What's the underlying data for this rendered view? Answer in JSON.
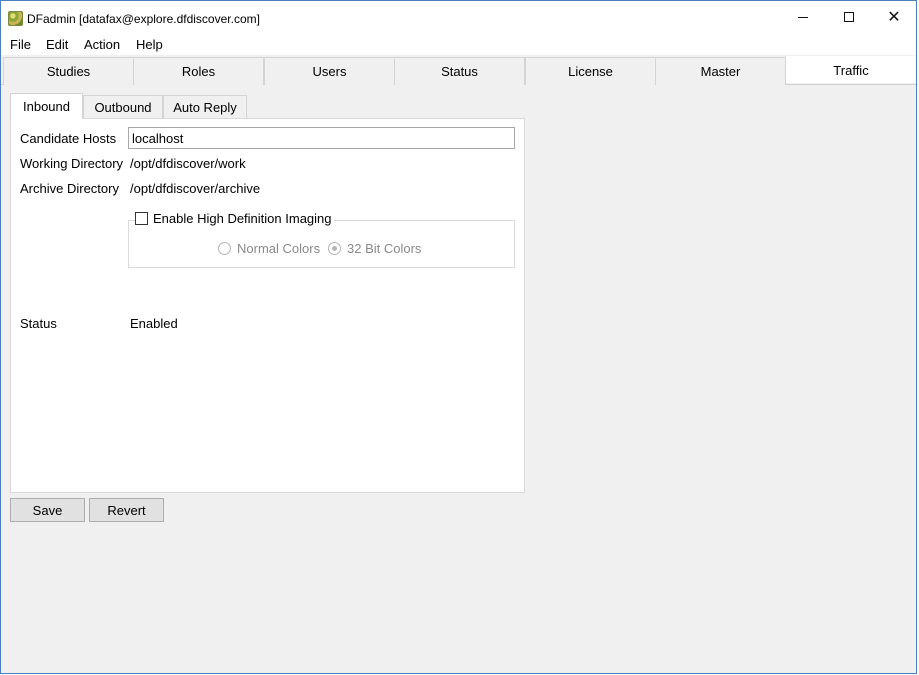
{
  "window": {
    "title": "DFadmin [datafax@explore.dfdiscover.com]",
    "controls": {
      "minimize": "minimize",
      "maximize": "maximize",
      "close": "✕"
    }
  },
  "menu": [
    "File",
    "Edit",
    "Action",
    "Help"
  ],
  "main_tabs": [
    "Studies",
    "Roles",
    "Users",
    "Status",
    "License",
    "Master",
    "Traffic"
  ],
  "active_main_tab": "Traffic",
  "sub_tabs": [
    "Inbound",
    "Outbound",
    "Auto Reply"
  ],
  "active_sub_tab": "Inbound",
  "inbound": {
    "candidate_hosts_label": "Candidate Hosts",
    "candidate_hosts_value": "localhost",
    "working_directory_label": "Working Directory",
    "working_directory_value": "/opt/dfdiscover/work",
    "archive_directory_label": "Archive Directory",
    "archive_directory_value": "/opt/dfdiscover/archive",
    "hd_imaging_label": "Enable High Definition Imaging",
    "hd_imaging_checked": false,
    "color_options": [
      {
        "label": "Normal Colors",
        "selected": false
      },
      {
        "label": "32 Bit Colors",
        "selected": true
      }
    ],
    "status_label": "Status",
    "status_value": "Enabled"
  },
  "buttons": {
    "save": "Save",
    "revert": "Revert"
  },
  "colors": {
    "window_border": "#4a7fc1",
    "background": "#f0f0f0",
    "active_tab": "#ffffff",
    "disabled_text": "#8a8a8a"
  }
}
